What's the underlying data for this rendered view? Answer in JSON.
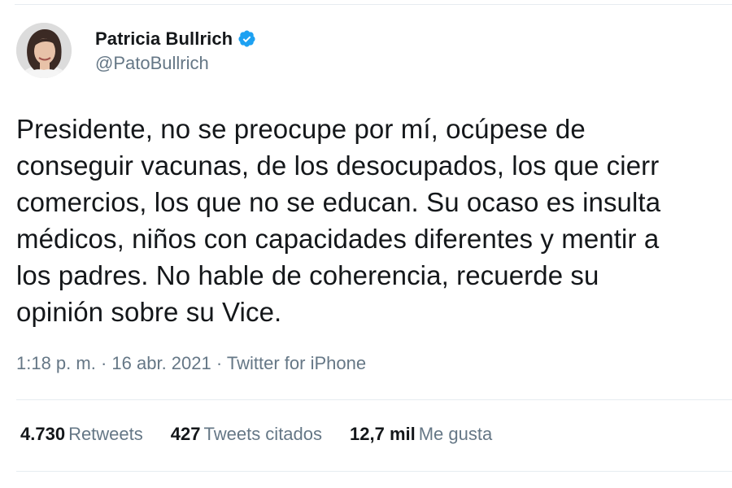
{
  "author": {
    "display_name": "Patricia Bullrich",
    "handle": "@PatoBullrich",
    "verified": true
  },
  "tweet": {
    "lines": [
      "Presidente, no se preocupe por mí, ocúpese de",
      "conseguir vacunas, de los desocupados, los que cierr",
      "comercios, los que no se educan. Su ocaso es insulta",
      "médicos, niños con capacidades diferentes y mentir a",
      "los padres. No hable de coherencia, recuerde su",
      "opinión sobre su Vice."
    ]
  },
  "meta": {
    "time": "1:18 p. m.",
    "separator1": " · ",
    "date": "16 abr. 2021",
    "separator2": " · ",
    "source": "Twitter for iPhone"
  },
  "stats": {
    "retweets_count": "4.730",
    "retweets_label": "Retweets",
    "quotes_count": "427",
    "quotes_label": "Tweets citados",
    "likes_count": "12,7 mil",
    "likes_label": "Me gusta"
  },
  "colors": {
    "text_primary": "#14171a",
    "text_secondary": "#657786",
    "verified_blue": "#1da1f2",
    "divider": "#e6ecf0"
  },
  "icons": {
    "verified": "verified-badge-icon"
  }
}
